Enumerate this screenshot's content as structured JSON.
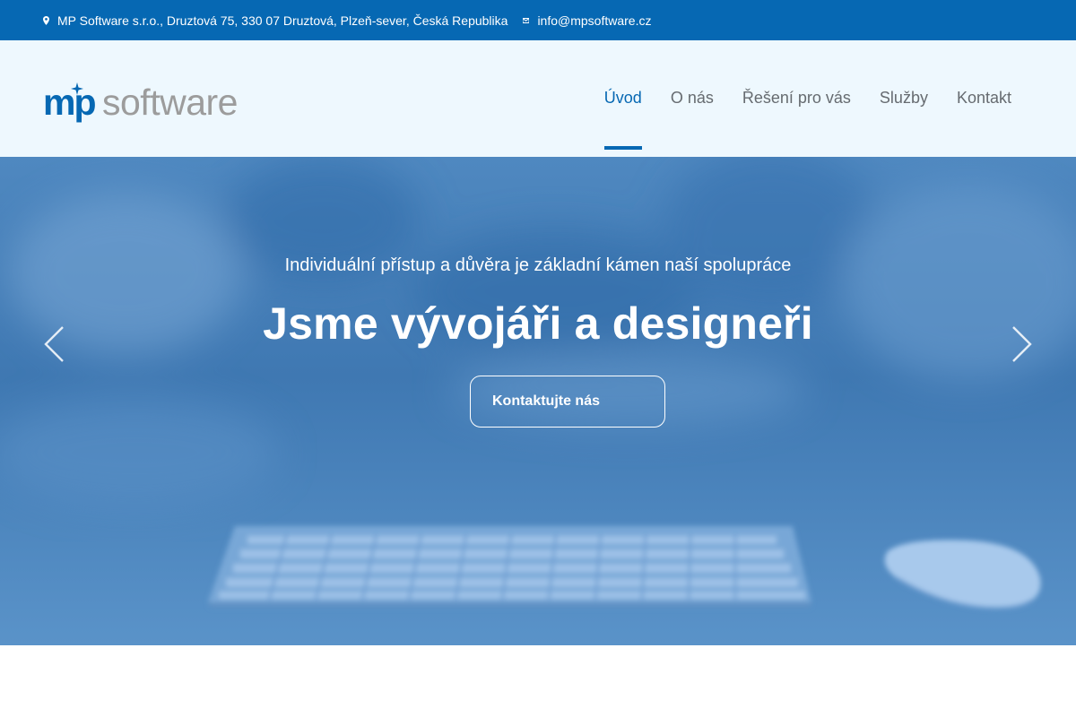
{
  "topbar": {
    "address": "MP Software s.r.o., Druztová 75, 330 07 Druztová, Plzeň-sever, Česká Republika",
    "email": "info@mpsoftware.cz",
    "background": "#0668b3",
    "address_icon": "map-marker-icon",
    "email_icon": "envelope-icon"
  },
  "logo": {
    "part_mp": "mp",
    "part_software": "software",
    "mp_color": "#0668b3",
    "software_color": "#9c9c9c"
  },
  "nav": {
    "items": [
      {
        "label": "Úvod",
        "active": true
      },
      {
        "label": "O nás"
      },
      {
        "label": "Řešení pro vás"
      },
      {
        "label": "Služby"
      },
      {
        "label": "Kontakt"
      }
    ],
    "active_color": "#0668b3"
  },
  "hero": {
    "subtitle": "Individuální přístup a důvěra je základní kámen naší spolupráce",
    "title": "Jsme vývojáři a designeři",
    "cta_label": "Kontaktujte nás",
    "prev_icon": "chevron-left-icon",
    "next_icon": "chevron-right-icon",
    "overlay_color": "#4a84bd"
  }
}
